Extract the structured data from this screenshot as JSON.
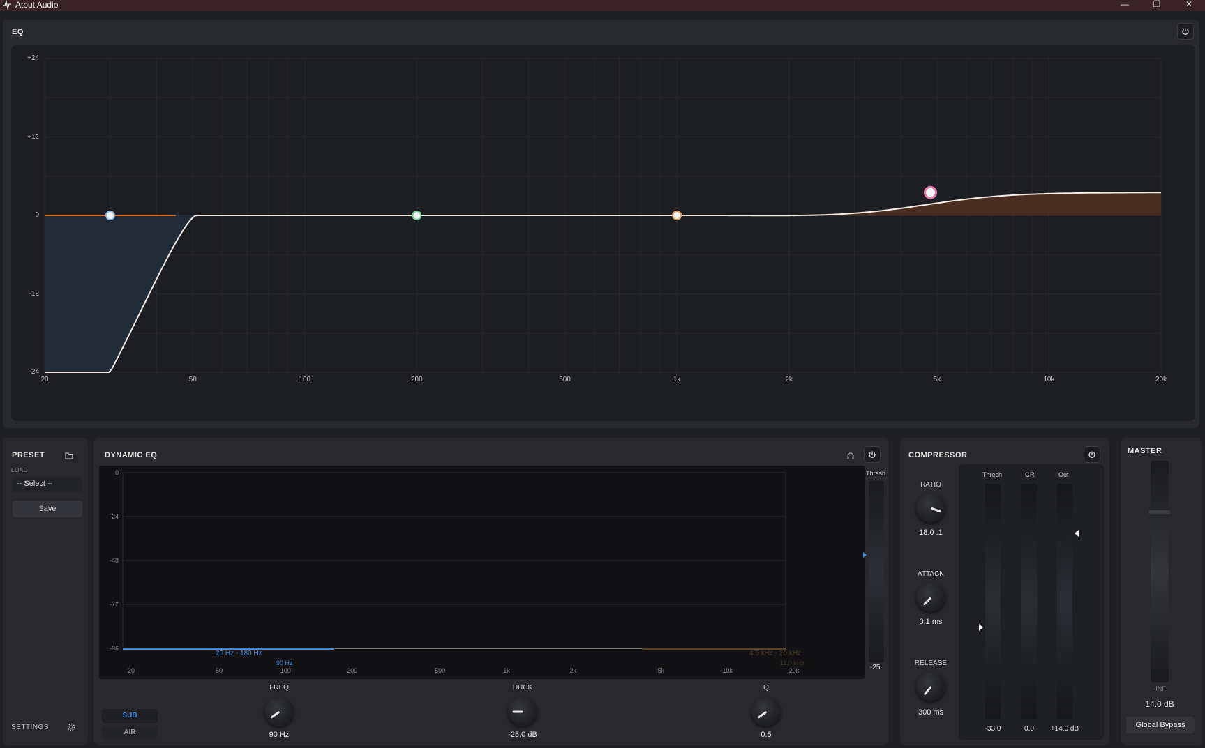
{
  "window": {
    "title": "Atout Audio",
    "minimize": "—",
    "maximize": "❐",
    "close": "✕"
  },
  "eq": {
    "title": "EQ",
    "y_labels": [
      "+24",
      "+12",
      "0",
      "-12",
      "-24"
    ],
    "x_labels": [
      "20",
      "50",
      "100",
      "200",
      "500",
      "1k",
      "2k",
      "5k",
      "10k",
      "20k"
    ],
    "bands": [
      {
        "freq_hz": 30,
        "gain_db": 0,
        "color": "#8fb8e6"
      },
      {
        "freq_hz": 200,
        "gain_db": 0,
        "color": "#6fcf97"
      },
      {
        "freq_hz": 1000,
        "gain_db": 0,
        "color": "#e0a060"
      },
      {
        "freq_hz": 4800,
        "gain_db": 3.5,
        "color": "#e07aa8"
      }
    ]
  },
  "preset": {
    "title": "PRESET",
    "load_label": "LOAD",
    "select_value": "-- Select --",
    "save_label": "Save",
    "settings_label": "SETTINGS"
  },
  "dynamic_eq": {
    "title": "DYNAMIC EQ",
    "y_labels": [
      "0",
      "-24",
      "-48",
      "-72",
      "-96"
    ],
    "x_labels": [
      "20",
      "50",
      "100",
      "200",
      "500",
      "1k",
      "2k",
      "5k",
      "10k",
      "20k"
    ],
    "thresh_label": "Thresh",
    "thresh_value": "-25",
    "sub_range": "20 Hz - 180 Hz",
    "sub_freq": "90 Hz",
    "air_range": "4.5 kHz - 20 kHz",
    "air_freq": "11.0 kHz",
    "tabs": [
      "SUB",
      "AIR"
    ],
    "knobs": [
      {
        "label": "FREQ",
        "value": "90 Hz"
      },
      {
        "label": "DUCK",
        "value": "-25.0 dB"
      },
      {
        "label": "Q",
        "value": "0.5"
      }
    ]
  },
  "compressor": {
    "title": "COMPRESSOR",
    "knobs": [
      {
        "label": "RATIO",
        "value": "18.0 :1"
      },
      {
        "label": "ATTACK",
        "value": "0.1 ms"
      },
      {
        "label": "RELEASE",
        "value": "300 ms"
      }
    ],
    "meters": [
      {
        "label": "Thresh",
        "value": "-33.0"
      },
      {
        "label": "GR",
        "value": "0.0"
      },
      {
        "label": "Out",
        "value": "+14.0 dB"
      }
    ]
  },
  "master": {
    "title": "MASTER",
    "fader_min": "-INF",
    "value": "14.0 dB",
    "bypass_label": "Global Bypass"
  }
}
